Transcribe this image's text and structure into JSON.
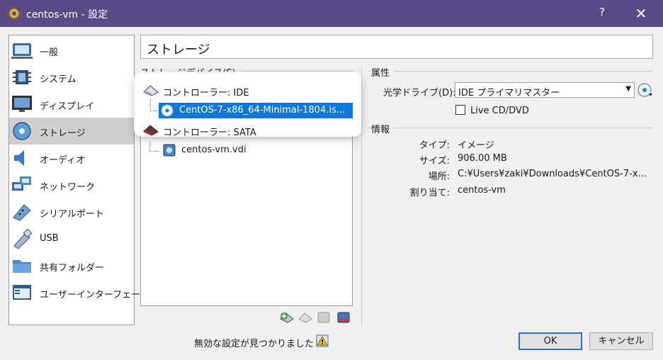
{
  "window": {
    "title": "centos-vm - 設定",
    "help_label": "?",
    "close_label": "✕"
  },
  "sidebar": {
    "items": [
      {
        "label": "一般",
        "icon": "general-icon",
        "selected": false
      },
      {
        "label": "システム",
        "icon": "system-icon",
        "selected": false
      },
      {
        "label": "ディスプレイ",
        "icon": "display-icon",
        "selected": false
      },
      {
        "label": "ストレージ",
        "icon": "storage-icon",
        "selected": true
      },
      {
        "label": "オーディオ",
        "icon": "audio-icon",
        "selected": false
      },
      {
        "label": "ネットワーク",
        "icon": "network-icon",
        "selected": false
      },
      {
        "label": "シリアルポート",
        "icon": "serial-port-icon",
        "selected": false
      },
      {
        "label": "USB",
        "icon": "usb-icon",
        "selected": false
      },
      {
        "label": "共有フォルダー",
        "icon": "shared-folder-icon",
        "selected": false
      },
      {
        "label": "ユーザーインターフェース",
        "icon": "user-interface-icon",
        "selected": false
      }
    ]
  },
  "page": {
    "title": "ストレージ"
  },
  "storage_devices": {
    "label": "ストレージデバイス(S)",
    "controllers": [
      {
        "label": "コントローラー: IDE",
        "attachments": [
          {
            "label": "CentOS-7-x86_64-Minimal-1804.is...",
            "selected": true
          }
        ]
      },
      {
        "label": "コントローラー: SATA",
        "attachments": [
          {
            "label": "centos-vm.vdi",
            "selected": false
          }
        ]
      }
    ]
  },
  "attributes": {
    "label": "属性",
    "optical_drive_label": "光学ドライブ(D):",
    "optical_drive_value": "IDE プライマリマスター",
    "live_cd_label": "Live CD/DVD",
    "live_cd_checked": false
  },
  "info": {
    "label": "情報",
    "rows": [
      {
        "key": "タイプ:",
        "value": "イメージ"
      },
      {
        "key": "サイズ:",
        "value": "906.00 MB"
      },
      {
        "key": "場所:",
        "value": "C:¥Users¥zaki¥Downloads¥CentOS-7-x..."
      },
      {
        "key": "割り当て:",
        "value": "centos-vm"
      }
    ]
  },
  "footer": {
    "warning": "無効な設定が見つかりました",
    "ok_label": "OK",
    "cancel_label": "キャンセル"
  },
  "colors": {
    "titlebar": "#5a4b87",
    "selection": "#0e78d7",
    "sidebar_selected": "#cfcfcf"
  }
}
